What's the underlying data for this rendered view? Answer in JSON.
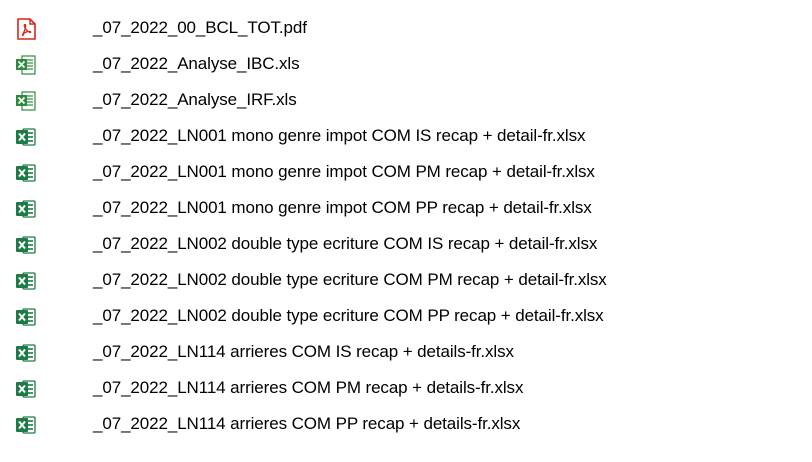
{
  "file_list": {
    "items": [
      {
        "name": "_07_2022_00_BCL_TOT.pdf",
        "icon": "pdf-icon"
      },
      {
        "name": "_07_2022_Analyse_IBC.xls",
        "icon": "excel-legacy-icon"
      },
      {
        "name": "_07_2022_Analyse_IRF.xls",
        "icon": "excel-legacy-icon"
      },
      {
        "name": "_07_2022_LN001 mono genre impot COM IS recap + detail-fr.xlsx",
        "icon": "excel-icon"
      },
      {
        "name": "_07_2022_LN001 mono genre impot COM PM recap + detail-fr.xlsx",
        "icon": "excel-icon"
      },
      {
        "name": "_07_2022_LN001 mono genre impot COM PP recap + detail-fr.xlsx",
        "icon": "excel-icon"
      },
      {
        "name": "_07_2022_LN002 double type ecriture COM IS recap + detail-fr.xlsx",
        "icon": "excel-icon"
      },
      {
        "name": "_07_2022_LN002 double type ecriture COM PM recap + detail-fr.xlsx",
        "icon": "excel-icon"
      },
      {
        "name": "_07_2022_LN002 double type ecriture COM PP recap + detail-fr.xlsx",
        "icon": "excel-icon"
      },
      {
        "name": "_07_2022_LN114 arrieres COM IS recap + details-fr.xlsx",
        "icon": "excel-icon"
      },
      {
        "name": "_07_2022_LN114 arrieres COM PM recap + details-fr.xlsx",
        "icon": "excel-icon"
      },
      {
        "name": "_07_2022_LN114 arrieres COM PP recap + details-fr.xlsx",
        "icon": "excel-icon"
      }
    ]
  },
  "colors": {
    "pdf_red": "#d9261c",
    "excel_green": "#1d7a45",
    "excel_legacy_green": "#2e8b3e",
    "text": "#000000"
  }
}
